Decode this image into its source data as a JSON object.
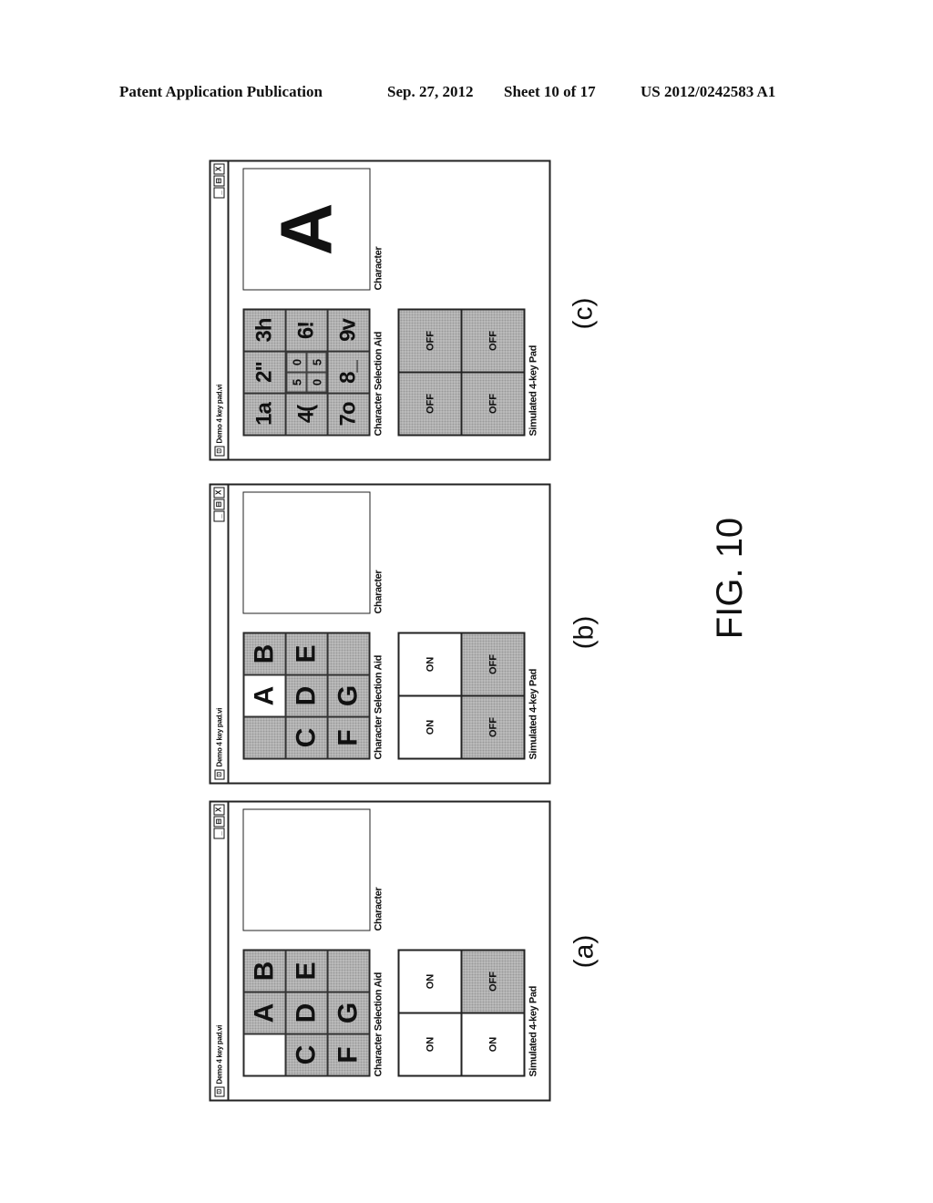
{
  "header": {
    "left": "Patent Application Publication",
    "date": "Sep. 27, 2012",
    "sheet": "Sheet 10 of 17",
    "number": "US 2012/0242583 A1"
  },
  "figure_label": "FIG. 10",
  "icons": {
    "app": "app-icon",
    "minimize": "_",
    "maximize": "⊟",
    "close": "X"
  },
  "panels": [
    {
      "caption": "(a)",
      "window_title": "Demo 4 key pad.vi",
      "grid_label": "Character Selection Aid",
      "char_label": "Character",
      "pad_label": "Simulated 4-key Pad",
      "character": "",
      "grid": [
        {
          "text": "",
          "on": true
        },
        {
          "text": "A",
          "on": false
        },
        {
          "text": "B",
          "on": false
        },
        {
          "text": "C",
          "on": false
        },
        {
          "text": "D",
          "on": false
        },
        {
          "text": "E",
          "on": false
        },
        {
          "text": "F",
          "on": false
        },
        {
          "text": "G",
          "on": false
        },
        {
          "text": "",
          "on": false
        }
      ],
      "pad": [
        {
          "text": "ON",
          "on": true
        },
        {
          "text": "ON",
          "on": true
        },
        {
          "text": "ON",
          "on": true
        },
        {
          "text": "OFF",
          "on": false
        }
      ]
    },
    {
      "caption": "(b)",
      "window_title": "Demo 4 key pad.vi",
      "grid_label": "Character Selection Aid",
      "char_label": "Character",
      "pad_label": "Simulated 4-key Pad",
      "character": "",
      "grid": [
        {
          "text": "",
          "on": false
        },
        {
          "text": "A",
          "on": true
        },
        {
          "text": "B",
          "on": false
        },
        {
          "text": "C",
          "on": false
        },
        {
          "text": "D",
          "on": false
        },
        {
          "text": "E",
          "on": false
        },
        {
          "text": "F",
          "on": false
        },
        {
          "text": "G",
          "on": false
        },
        {
          "text": "",
          "on": false
        }
      ],
      "pad": [
        {
          "text": "ON",
          "on": true
        },
        {
          "text": "ON",
          "on": true
        },
        {
          "text": "OFF",
          "on": false
        },
        {
          "text": "OFF",
          "on": false
        }
      ]
    },
    {
      "caption": "(c)",
      "window_title": "Demo 4 key pad.vi",
      "grid_label": "Character Selection Aid",
      "char_label": "Character",
      "pad_label": "Simulated 4-key Pad",
      "character": "A",
      "grid": [
        {
          "text": "1a",
          "on": false
        },
        {
          "text": "2\"",
          "on": false
        },
        {
          "text": "3h",
          "on": false
        },
        {
          "text": "4(",
          "on": false
        },
        {
          "mini": [
            "5",
            "0",
            "0",
            "5"
          ],
          "on": false
        },
        {
          "text": "6!",
          "on": false
        },
        {
          "text": "7o",
          "on": false
        },
        {
          "text": "8_",
          "on": false
        },
        {
          "text": "9v",
          "on": false
        }
      ],
      "pad": [
        {
          "text": "OFF",
          "on": false
        },
        {
          "text": "OFF",
          "on": false
        },
        {
          "text": "OFF",
          "on": false
        },
        {
          "text": "OFF",
          "on": false
        }
      ]
    }
  ]
}
